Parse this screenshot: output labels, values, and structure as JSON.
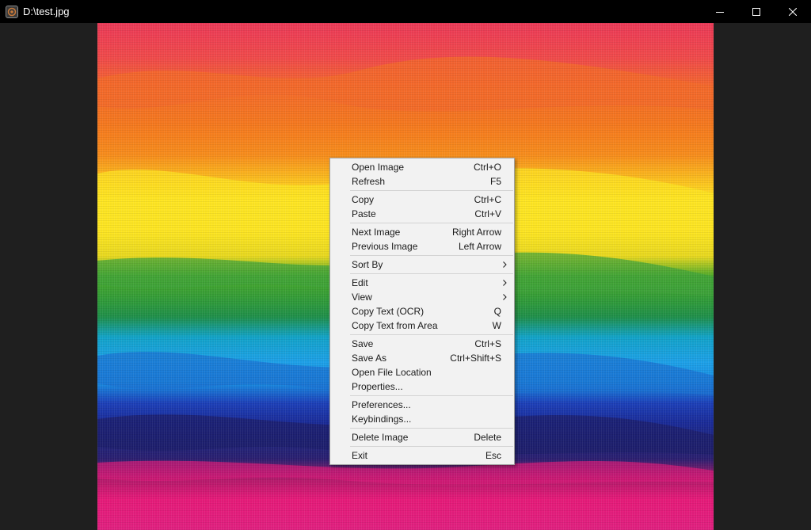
{
  "window": {
    "title": "D:\\test.jpg"
  },
  "icons": {
    "app": "app-icon",
    "minimize": "minimize-icon",
    "maximize": "maximize-icon",
    "close": "close-icon",
    "submenu": "chevron-right-icon"
  },
  "colors": {
    "titlebar_bg": "#000000",
    "window_bg": "#1f1f1f",
    "menu_bg": "#f2f2f2",
    "menu_text": "#1a1a1a",
    "menu_separator": "#d4d4d4"
  },
  "context_menu": {
    "groups": [
      [
        {
          "label": "Open Image",
          "shortcut": "Ctrl+O"
        },
        {
          "label": "Refresh",
          "shortcut": "F5"
        }
      ],
      [
        {
          "label": "Copy",
          "shortcut": "Ctrl+C"
        },
        {
          "label": "Paste",
          "shortcut": "Ctrl+V"
        }
      ],
      [
        {
          "label": "Next Image",
          "shortcut": "Right Arrow"
        },
        {
          "label": "Previous Image",
          "shortcut": "Left Arrow"
        }
      ],
      [
        {
          "label": "Sort By",
          "shortcut": "",
          "submenu": true
        }
      ],
      [
        {
          "label": "Edit",
          "shortcut": "",
          "submenu": true
        },
        {
          "label": "View",
          "shortcut": "",
          "submenu": true
        },
        {
          "label": "Copy Text (OCR)",
          "shortcut": "Q"
        },
        {
          "label": "Copy Text from Area",
          "shortcut": "W"
        }
      ],
      [
        {
          "label": "Save",
          "shortcut": "Ctrl+S"
        },
        {
          "label": "Save As",
          "shortcut": "Ctrl+Shift+S"
        },
        {
          "label": "Open File Location",
          "shortcut": ""
        },
        {
          "label": "Properties...",
          "shortcut": ""
        }
      ],
      [
        {
          "label": "Preferences...",
          "shortcut": ""
        },
        {
          "label": "Keybindings...",
          "shortcut": ""
        }
      ],
      [
        {
          "label": "Delete Image",
          "shortcut": "Delete"
        }
      ],
      [
        {
          "label": "Exit",
          "shortcut": "Esc"
        }
      ]
    ]
  }
}
